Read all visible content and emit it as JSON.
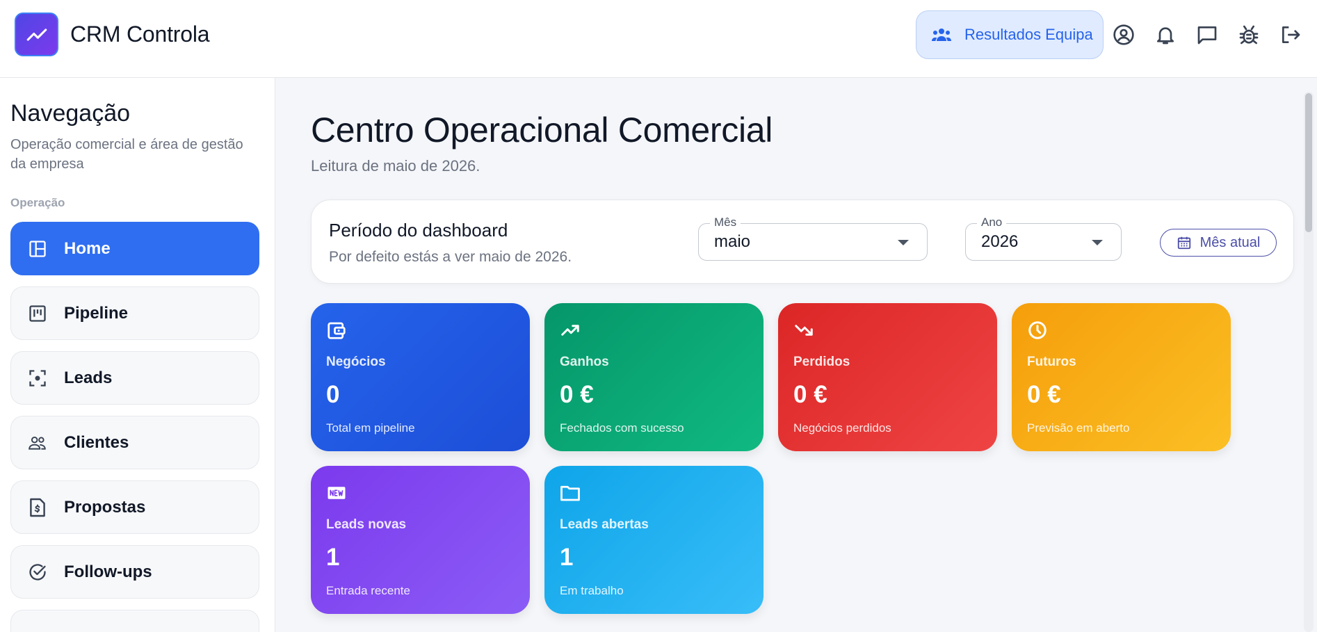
{
  "header": {
    "app_title": "CRM Controla",
    "team_button_label": "Resultados Equipa",
    "icons": [
      "trending-up-icon",
      "group-icon",
      "account-circle-icon",
      "bell-icon",
      "chat-icon",
      "bug-icon",
      "logout-icon"
    ]
  },
  "sidebar": {
    "title": "Navegação",
    "subtitle": "Operação comercial e área de gestão da empresa",
    "section": "Operação",
    "items": [
      {
        "label": "Home",
        "icon": "dashboard-icon",
        "active": true
      },
      {
        "label": "Pipeline",
        "icon": "kanban-icon",
        "active": false
      },
      {
        "label": "Leads",
        "icon": "target-icon",
        "active": false
      },
      {
        "label": "Clientes",
        "icon": "people-icon",
        "active": false
      },
      {
        "label": "Propostas",
        "icon": "document-euro-icon",
        "active": false
      },
      {
        "label": "Follow-ups",
        "icon": "check-circle-icon",
        "active": false
      }
    ]
  },
  "main": {
    "title": "Centro Operacional Comercial",
    "subtitle": "Leitura de maio de 2026.",
    "period": {
      "title": "Período do dashboard",
      "subtitle": "Por defeito estás a ver maio de 2026.",
      "month_label": "Mês",
      "month_value": "maio",
      "year_label": "Ano",
      "year_value": "2026",
      "current_month_button": "Mês atual"
    },
    "kpis": [
      {
        "label": "Negócios",
        "value": "0",
        "foot": "Total em pipeline",
        "icon": "wallet-icon",
        "color_from": "#2563eb",
        "color_to": "#1d4ed8"
      },
      {
        "label": "Ganhos",
        "value": "0 €",
        "foot": "Fechados com sucesso",
        "icon": "trending-up-icon",
        "color_from": "#059669",
        "color_to": "#10b981"
      },
      {
        "label": "Perdidos",
        "value": "0 €",
        "foot": "Negócios perdidos",
        "icon": "trending-down-icon",
        "color_from": "#dc2626",
        "color_to": "#ef4444"
      },
      {
        "label": "Futuros",
        "value": "0 €",
        "foot": "Previsão em aberto",
        "icon": "clock-icon",
        "color_from": "#f59e0b",
        "color_to": "#fbbf24"
      },
      {
        "label": "Leads novas",
        "value": "1",
        "foot": "Entrada recente",
        "icon": "new-badge-icon",
        "color_from": "#7c3aed",
        "color_to": "#8b5cf6"
      },
      {
        "label": "Leads abertas",
        "value": "1",
        "foot": "Em trabalho",
        "icon": "folder-icon",
        "color_from": "#0ea5e9",
        "color_to": "#38bdf8"
      }
    ]
  }
}
